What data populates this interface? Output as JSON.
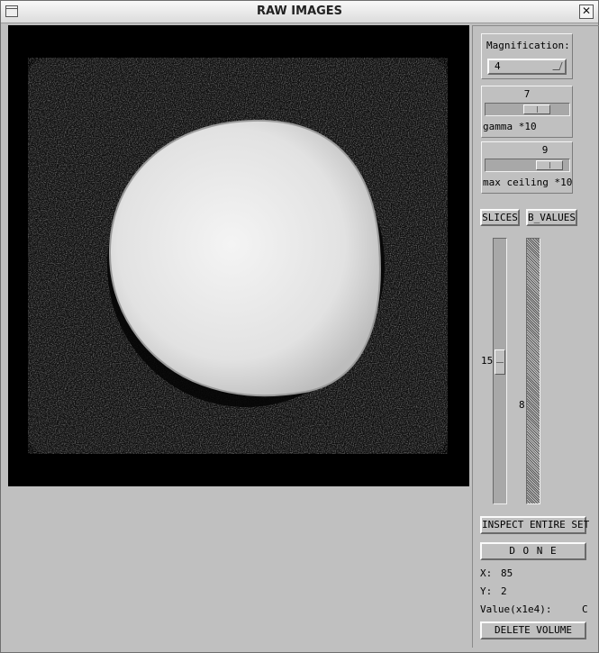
{
  "window": {
    "title": "RAW IMAGES",
    "close_glyph": "✕"
  },
  "magnification": {
    "label": "Magnification:",
    "value": "4"
  },
  "gamma": {
    "value": "7",
    "label": "gamma *10",
    "level_fraction": 0.55
  },
  "max_ceiling": {
    "value": "9",
    "label": "max ceiling *10",
    "level_fraction": 0.75
  },
  "buttons": {
    "slices": "SLICES",
    "b_values": "B_VALUES",
    "inspect": "INSPECT ENTIRE SET",
    "done": "D O N E",
    "delete": "DELETE VOLUME"
  },
  "slice_slider": {
    "value": "15",
    "level_fraction": 0.5
  },
  "bvalue_slider": {
    "value": "8",
    "disabled": true
  },
  "readout": {
    "x_label": "X:",
    "x_value": "85",
    "y_label": "Y:",
    "y_value": "2",
    "value_label": "Value(x1e4):",
    "value_value": "C"
  },
  "image": {
    "description_icon": "mri-phantom-image"
  }
}
